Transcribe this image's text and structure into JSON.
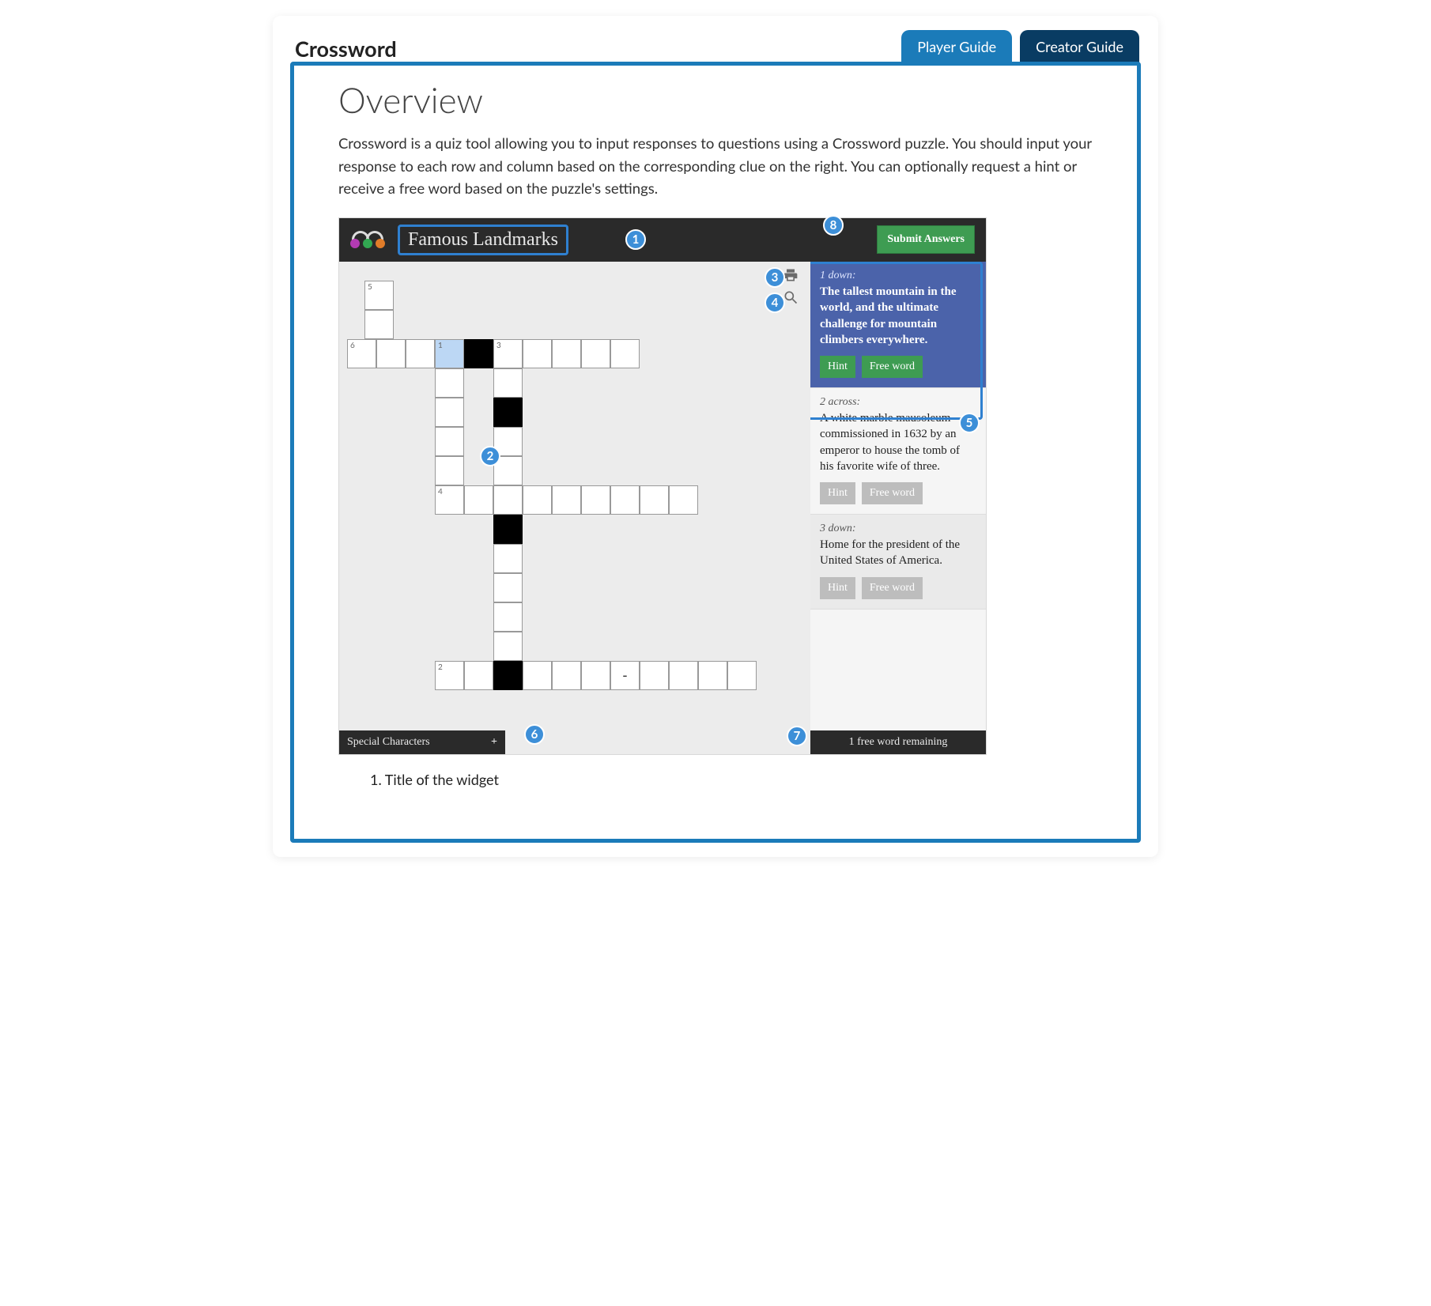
{
  "header": {
    "title": "Crossword",
    "tabs": {
      "player": "Player Guide",
      "creator": "Creator Guide"
    }
  },
  "overview": {
    "heading": "Overview",
    "text": "Crossword is a quiz tool allowing you to input responses to questions using a Crossword puzzle. You should input your response to each row and column based on the corresponding clue on the right. You can optionally request a hint or receive a free word based on the puzzle's settings."
  },
  "widget": {
    "title": "Famous Landmarks",
    "submit": "Submit Answers",
    "special_chars": "Special Characters",
    "special_chars_plus": "+",
    "free_remaining": "1 free word remaining",
    "clues": [
      {
        "dir": "1 down:",
        "text": "The tallest mountain in the world, and the ultimate challenge for mountain climbers everywhere.",
        "hint": "Hint",
        "free": "Free word",
        "active": true
      },
      {
        "dir": "2 across:",
        "text": "A white marble mausoleum commissioned in 1632 by an emperor to house the tomb of his favorite wife of three.",
        "hint": "Hint",
        "free": "Free word",
        "active": false
      },
      {
        "dir": "3 down:",
        "text": "Home for the president of the United States of America.",
        "hint": "Hint",
        "free": "Free word",
        "active": false
      }
    ],
    "cell_labels": {
      "n5": "5",
      "n6": "6",
      "n1": "1",
      "n3": "3",
      "n4": "4",
      "n2": "2"
    }
  },
  "badges": {
    "b1": "1",
    "b2": "2",
    "b3": "3",
    "b4": "4",
    "b5": "5",
    "b6": "6",
    "b7": "7",
    "b8": "8"
  },
  "legend": {
    "item1": "1. Title of the widget"
  }
}
